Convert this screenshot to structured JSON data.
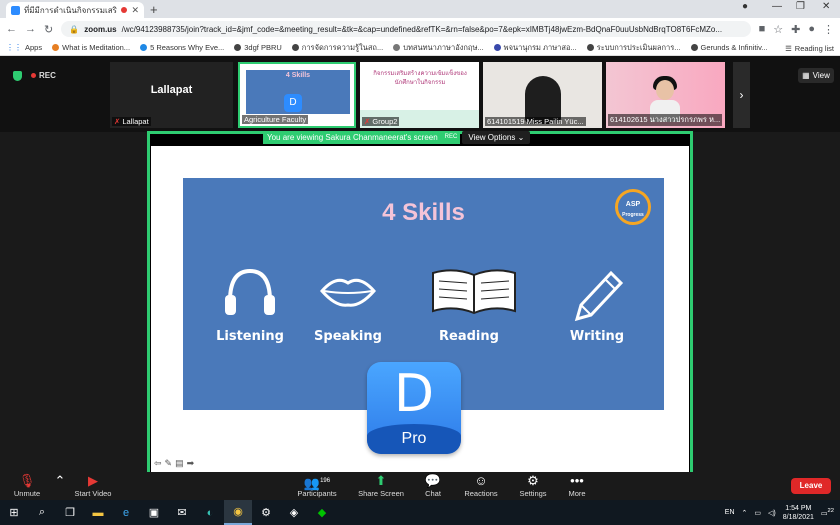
{
  "browser": {
    "tab_title": "ที่มีมีการดำเนินกิจกรรมเสริมหลักสูตร...",
    "url_domain": "zoom.us",
    "url_path": "/wc/94123988735/join?track_id=&jmf_code=&meeting_result=&tk=&cap=undefined&refTK=&rn=false&po=7&epk=xIMBTj48jwEzm-BdQnaF0uuUsbNdBrqTO8T6FcMZo...",
    "bookmarks": [
      "Apps",
      "What is Meditation...",
      "5 Reasons Why Eve...",
      "3dgf PBRU",
      "การจัดการความรู้ในสถ...",
      "บทสนทนาภาษาอังกฤษ...",
      "พจนานุกรม ภาษาสอ...",
      "ระบบการประเมินผลการ...",
      "Gerunds & Infinitiv..."
    ],
    "reading_list": "Reading list"
  },
  "zoom": {
    "rec_label": "REC",
    "view_label": "View",
    "tiles": [
      {
        "big_name": "Lallapat",
        "label": "Lallapat"
      },
      {
        "label": "Agriculture Faculty"
      },
      {
        "label": "Group2",
        "text": "กิจกรรมเสริมสร้างความเข้มแข็งของนักศึกษาในกิจกรรม"
      },
      {
        "label": "614101519 Miss Pailin Yüc..."
      },
      {
        "label": "614102615 นางสาวปรกรภพร ห..."
      }
    ],
    "viewing_text": "You are viewing Sakura Chanmaneerat's screen",
    "viewing_rec": "REC",
    "view_options": "View Options",
    "slide": {
      "title": "4 Skills",
      "logo_top": "ASP",
      "logo_bottom": "Progress",
      "skills": [
        "Listening",
        "Speaking",
        "Reading",
        "Writing"
      ],
      "mini_title": "4 Skills",
      "app_letter": "D",
      "app_sub": "Pro"
    },
    "controls": {
      "unmute": "Unmute",
      "start_video": "Start Video",
      "participants": "Participants",
      "participants_count": "196",
      "share_screen": "Share Screen",
      "chat": "Chat",
      "reactions": "Reactions",
      "settings": "Settings",
      "more": "More",
      "leave": "Leave"
    }
  },
  "taskbar": {
    "lang": "EN",
    "time": "1:54 PM",
    "date": "8/18/2021",
    "notif": "22"
  }
}
